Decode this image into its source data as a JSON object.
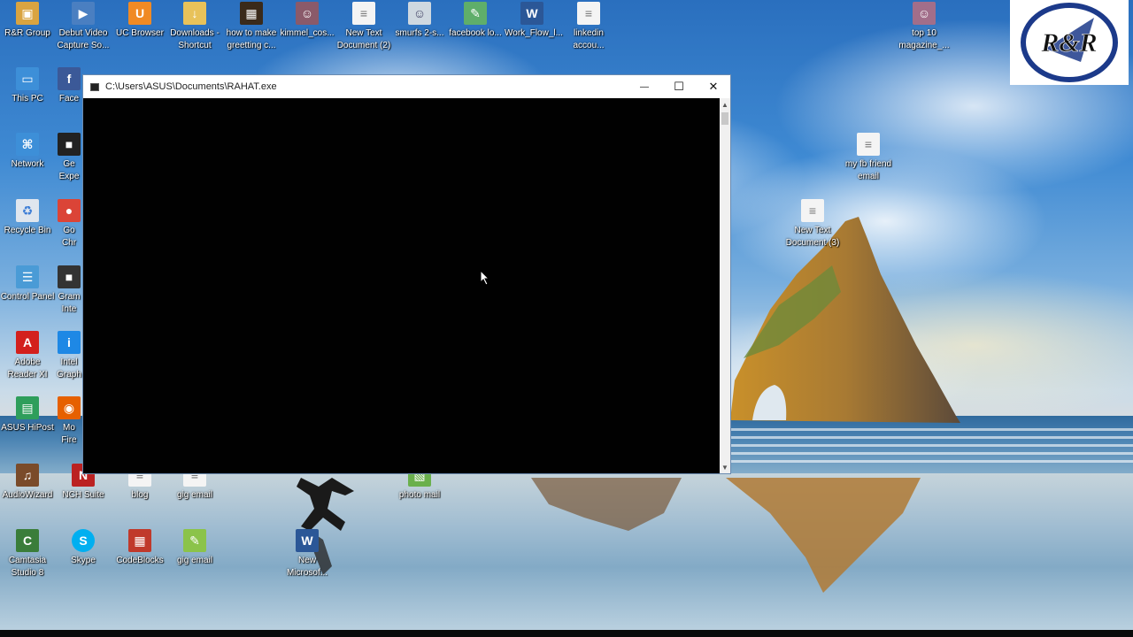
{
  "desktop": {
    "icons": [
      {
        "label": "R&R Group",
        "icon": "folder-user-icon",
        "color": "#d9a441"
      },
      {
        "label": "Debut Video\nCapture So...",
        "icon": "video-capture-icon",
        "color": "#4a7fc1"
      },
      {
        "label": "UC Browser",
        "icon": "uc-browser-icon",
        "color": "#f08a24"
      },
      {
        "label": "Downloads -\nShortcut",
        "icon": "downloads-folder-icon",
        "color": "#e8c25a"
      },
      {
        "label": "how to make\ngreetting c...",
        "icon": "video-file-icon",
        "color": "#3a2a1a"
      },
      {
        "label": "kimmel_cos...",
        "icon": "image-file-icon",
        "color": "#8a5a6a"
      },
      {
        "label": "New Text\nDocument (2)",
        "icon": "text-document-icon",
        "color": "#f4f4f4"
      },
      {
        "label": "smurfs 2-s...",
        "icon": "image-file-icon",
        "color": "#cfd8e0"
      },
      {
        "label": "facebook lo...",
        "icon": "notepad-icon",
        "color": "#5fae6a"
      },
      {
        "label": "Work_Flow_l...",
        "icon": "word-document-icon",
        "color": "#2b5797"
      },
      {
        "label": "linkedin\naccou...",
        "icon": "text-document-icon",
        "color": "#f4f4f4"
      },
      {
        "label": "top 10\nmagazine_...",
        "icon": "image-file-icon",
        "color": "#a26e8a"
      },
      {
        "label": "This PC",
        "icon": "computer-icon",
        "color": "#3d8fd8"
      },
      {
        "label": "Face",
        "icon": "facebook-icon",
        "color": "#3b5998"
      },
      {
        "label": "Network",
        "icon": "network-icon",
        "color": "#3d8fd8"
      },
      {
        "label": "Ge\nExpe",
        "icon": "app-icon",
        "color": "#222"
      },
      {
        "label": "Recycle Bin",
        "icon": "recycle-bin-icon",
        "color": "#e0e6ee"
      },
      {
        "label": "Go\nChr",
        "icon": "chrome-icon",
        "color": "#db4437"
      },
      {
        "label": "Control Panel",
        "icon": "control-panel-icon",
        "color": "#4a9bd6"
      },
      {
        "label": "Gram\nInte",
        "icon": "app-icon",
        "color": "#333"
      },
      {
        "label": "Adobe\nReader XI",
        "icon": "adobe-reader-icon",
        "color": "#d3201d"
      },
      {
        "label": "Intel\nGraph",
        "icon": "intel-graphics-icon",
        "color": "#1e88e5"
      },
      {
        "label": "ASUS HiPost",
        "icon": "asus-hipost-icon",
        "color": "#2e9e5b"
      },
      {
        "label": "Mo\nFire",
        "icon": "firefox-icon",
        "color": "#e66000"
      },
      {
        "label": "AudioWizard",
        "icon": "audio-wizard-icon",
        "color": "#7a4b2a"
      },
      {
        "label": "NCH Suite",
        "icon": "nch-suite-icon",
        "color": "#b22"
      },
      {
        "label": "blog",
        "icon": "text-document-icon",
        "color": "#f4f4f4"
      },
      {
        "label": "gig email",
        "icon": "text-document-icon",
        "color": "#f4f4f4"
      },
      {
        "label": "photo mail",
        "icon": "image-file-icon",
        "color": "#6ab04c"
      },
      {
        "label": "Camtasia\nStudio 8",
        "icon": "camtasia-icon",
        "color": "#3a7d3a"
      },
      {
        "label": "Skype",
        "icon": "skype-icon",
        "color": "#00aff0"
      },
      {
        "label": "CodeBlocks",
        "icon": "codeblocks-icon",
        "color": "#c0392b"
      },
      {
        "label": "gig email",
        "icon": "notepad-icon",
        "color": "#8bc34a"
      },
      {
        "label": "New\nMicrosof...",
        "icon": "word-document-icon",
        "color": "#2b5797"
      },
      {
        "label": "my fb friend\nemail",
        "icon": "text-document-icon",
        "color": "#f4f4f4"
      },
      {
        "label": "New Text\nDocument (3)",
        "icon": "text-document-icon",
        "color": "#f4f4f4"
      }
    ]
  },
  "logo": {
    "text": "R&R",
    "icon": "rr-logo-icon",
    "color": "#1c3a8a"
  },
  "console_window": {
    "title": "C:\\Users\\ASUS\\Documents\\RAHAT.exe",
    "minimize_glyph": "—",
    "maximize_glyph": "☐",
    "close_glyph": "✕",
    "scroll_up_glyph": "▲",
    "scroll_down_glyph": "▼",
    "background": "#010101"
  }
}
